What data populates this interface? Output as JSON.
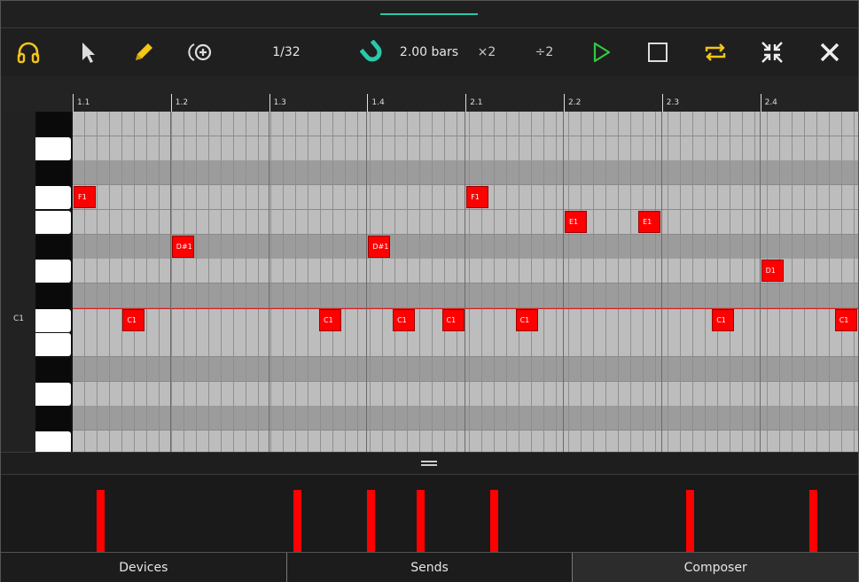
{
  "toolbar": {
    "quantize_label": "1/32",
    "length_label": "2.00 bars",
    "double_label": "×2",
    "halve_label": "÷2"
  },
  "colors": {
    "accent": "#28c9a9",
    "headphones": "#f5c518",
    "pencil": "#f5c518",
    "play": "#2ecc40",
    "loop": "#f5c518",
    "note": "#ff0000"
  },
  "ruler": {
    "marks": [
      "1.1",
      "1.2",
      "1.3",
      "1.4",
      "2.1",
      "2.2",
      "2.3",
      "2.4"
    ]
  },
  "keyboard": {
    "pitch_label": "C1"
  },
  "notes": [
    {
      "label": "F1",
      "row": 3,
      "col": 0
    },
    {
      "label": "F1",
      "row": 3,
      "col": 32
    },
    {
      "label": "E1",
      "row": 4,
      "col": 40
    },
    {
      "label": "E1",
      "row": 4,
      "col": 46
    },
    {
      "label": "D#1",
      "row": 5,
      "col": 8
    },
    {
      "label": "D#1",
      "row": 5,
      "col": 24
    },
    {
      "label": "D1",
      "row": 6,
      "col": 56
    },
    {
      "label": "C1",
      "row": 8,
      "col": 4
    },
    {
      "label": "C1",
      "row": 8,
      "col": 20
    },
    {
      "label": "C1",
      "row": 8,
      "col": 26
    },
    {
      "label": "C1",
      "row": 8,
      "col": 30
    },
    {
      "label": "C1",
      "row": 8,
      "col": 36
    },
    {
      "label": "C1",
      "row": 8,
      "col": 52
    },
    {
      "label": "C1",
      "row": 8,
      "col": 62
    }
  ],
  "velocity_steps": [
    4,
    20,
    26,
    30,
    36,
    52,
    62
  ],
  "tabs": [
    "Devices",
    "Sends",
    "Composer"
  ]
}
